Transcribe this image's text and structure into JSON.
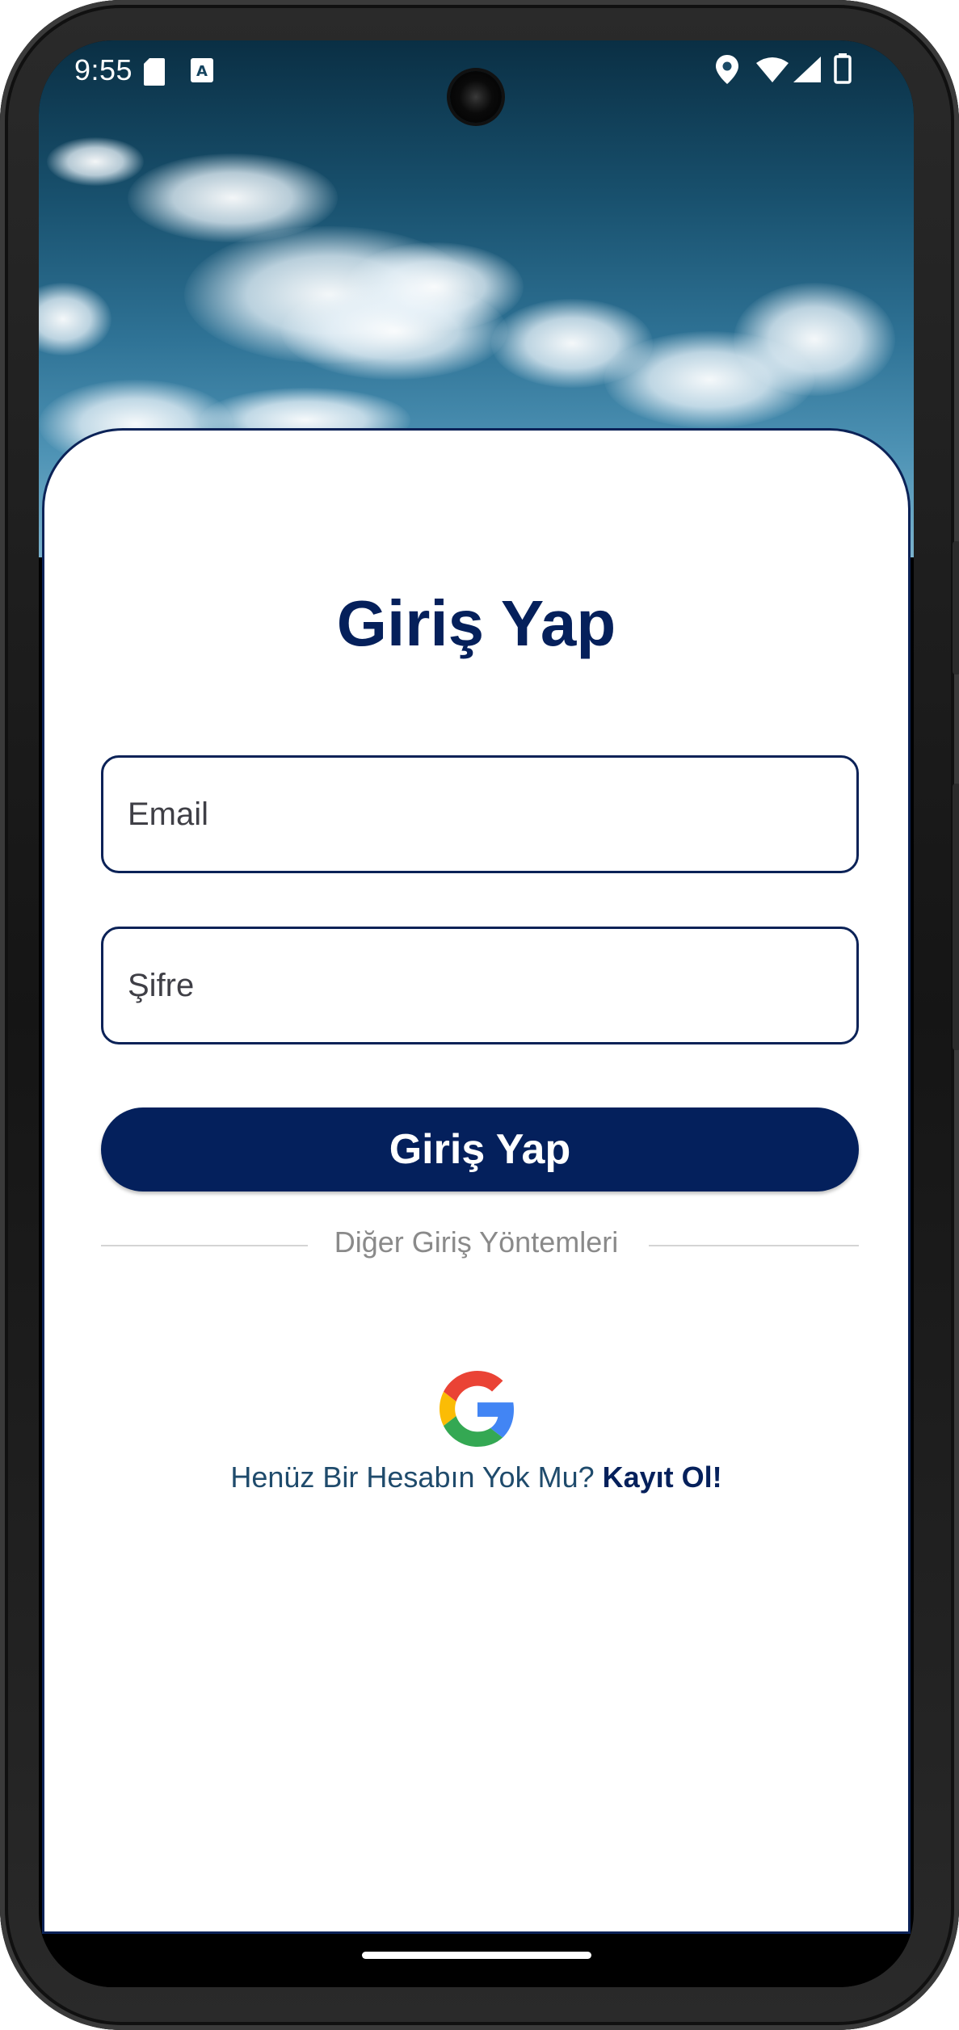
{
  "status_bar": {
    "time": "9:55",
    "icons": [
      "sd-card-icon",
      "text-a-icon",
      "location-icon",
      "wifi-icon",
      "signal-icon",
      "battery-icon"
    ]
  },
  "login": {
    "title": "Giriş Yap",
    "email_placeholder": "Email",
    "password_placeholder": "Şifre",
    "button_label": "Giriş Yap",
    "divider_text": "Diğer Giriş Yöntemleri",
    "social": [
      "google-logo-icon"
    ],
    "signup_prompt": "Henüz Bir Hesabın Yok Mu?",
    "signup_link": "Kayıt Ol!"
  },
  "colors": {
    "primary": "#04205c",
    "border": "#0b2257",
    "prompt_text": "#1f4b6c",
    "divider_text": "#8a8a8a"
  }
}
